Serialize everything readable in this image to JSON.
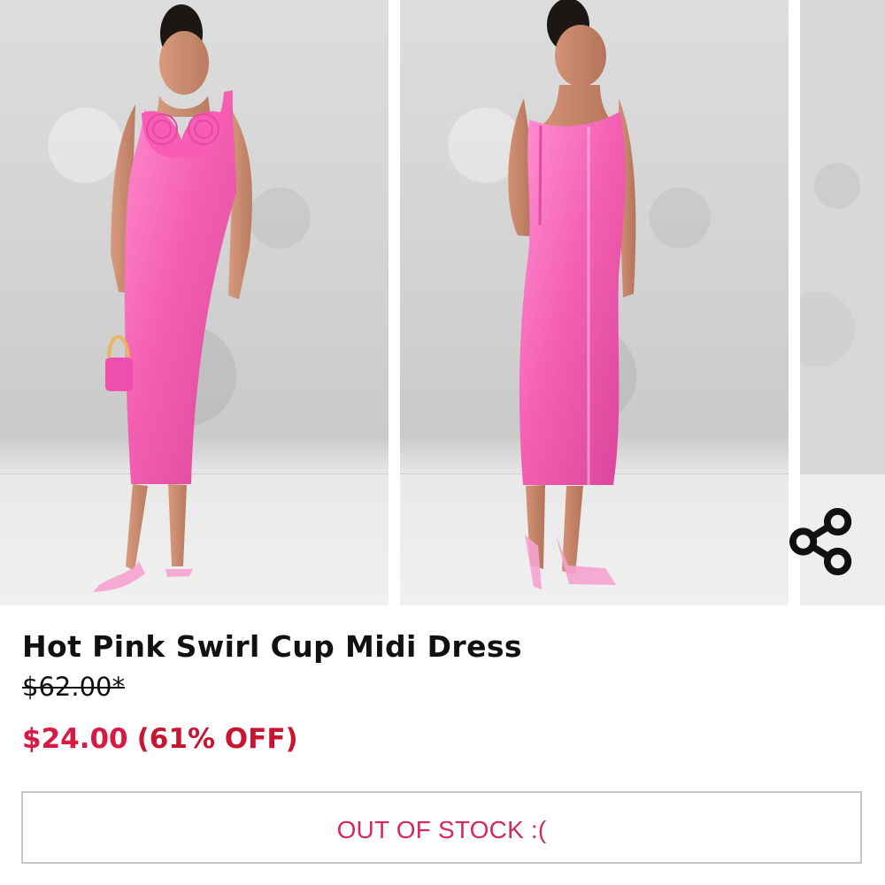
{
  "gallery": {
    "images": [
      {
        "name": "front-view"
      },
      {
        "name": "back-view"
      },
      {
        "name": "partial-next-image"
      }
    ],
    "share_icon": "share-icon"
  },
  "product": {
    "title": "Hot Pink Swirl Cup Midi Dress",
    "original_price": "$62.00*",
    "sale_price": "$24.00",
    "discount": "(61% OFF)"
  },
  "actions": {
    "out_of_stock_label": "OUT OF STOCK :("
  },
  "colors": {
    "sale_price": "#d71943",
    "discount": "#c81632",
    "button_text": "#d42a5a",
    "dress": "#f45fb1"
  }
}
